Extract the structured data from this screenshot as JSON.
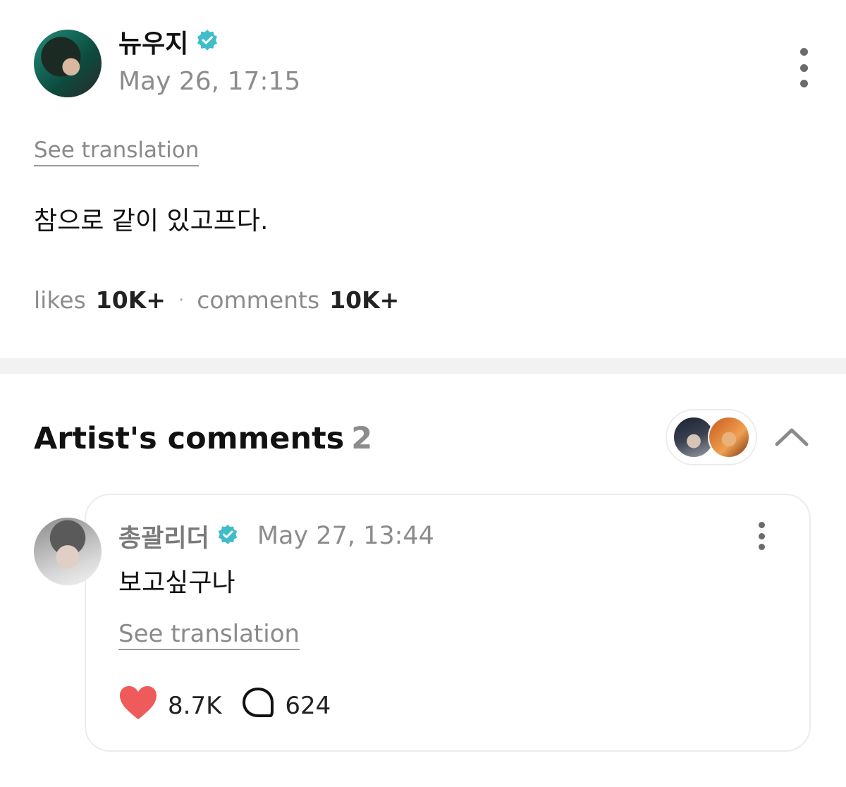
{
  "post": {
    "author": "뉴우지",
    "timestamp": "May 26, 17:15",
    "see_translation": "See translation",
    "body": "참으로 같이 있고프다.",
    "likes_label": "likes",
    "likes_count": "10K+",
    "separator": "·",
    "comments_label": "comments",
    "comments_count": "10K+"
  },
  "artist_comments": {
    "title": "Artist's comments",
    "count": "2",
    "comment": {
      "author": "총괄리더",
      "timestamp": "May 27, 13:44",
      "body": "보고싶구나",
      "see_translation": "See translation",
      "likes": "8.7K",
      "replies": "624"
    }
  },
  "colors": {
    "verified": "#3fbdc9",
    "heart": "#ef5b5b",
    "muted_text": "#8c8c8c",
    "divider": "#f2f2f2"
  },
  "icons": {
    "verified": "verified-badge-icon",
    "more": "more-vertical-icon",
    "collapse": "chevron-up-icon",
    "like": "heart-icon",
    "reply": "speech-bubble-icon"
  }
}
